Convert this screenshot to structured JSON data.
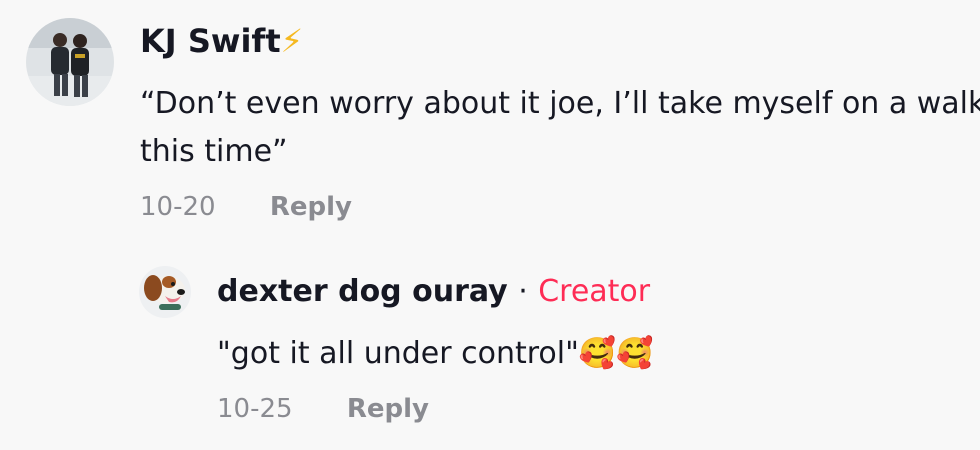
{
  "comment": {
    "username": "KJ Swift",
    "username_emoji": "⚡",
    "text_line1": "“Don’t even worry about it joe, I’ll take myself on a walk",
    "text_line2": "this time”",
    "date": "10-20",
    "reply_label": "Reply"
  },
  "reply_comment": {
    "username": "dexter dog ouray",
    "separator": "·",
    "badge": "Creator",
    "text": "\"got it all under control\"",
    "emojis": "🥰🥰",
    "date": "10-25",
    "reply_label": "Reply"
  },
  "colors": {
    "background": "#f8f8f8",
    "text": "#161823",
    "muted": "#8a8b91",
    "creator_badge": "#fe2c55",
    "bolt": "#f5b921"
  }
}
